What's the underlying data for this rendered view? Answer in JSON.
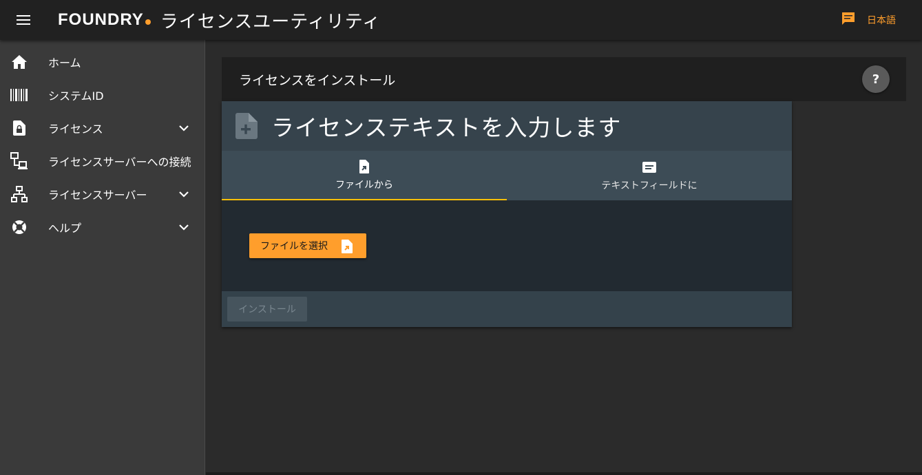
{
  "header": {
    "brand": "FOUNDRY",
    "app_title": "ライセンスユーティリティ",
    "language_label": "日本語",
    "accent_color": "#ff9e2c"
  },
  "sidebar": {
    "items": [
      {
        "label": "ホーム",
        "icon": "home-icon",
        "expandable": false
      },
      {
        "label": "システムID",
        "icon": "barcode-icon",
        "expandable": false
      },
      {
        "label": "ライセンス",
        "icon": "lock-file-icon",
        "expandable": true
      },
      {
        "label": "ライセンスサーバーへの接続",
        "icon": "network-connect-icon",
        "expandable": false
      },
      {
        "label": "ライセンスサーバー",
        "icon": "server-tree-icon",
        "expandable": true
      },
      {
        "label": "ヘルプ",
        "icon": "lifebuoy-icon",
        "expandable": true
      }
    ]
  },
  "main": {
    "page_title": "ライセンスをインストール",
    "help_label": "?",
    "card": {
      "title": "ライセンステキストを入力します",
      "tabs": [
        {
          "label": "ファイルから",
          "icon": "file-upload-icon",
          "active": true
        },
        {
          "label": "テキストフィールドに",
          "icon": "text-message-icon",
          "active": false
        }
      ],
      "choose_file_label": "ファイルを選択",
      "install_label": "インストール"
    }
  }
}
